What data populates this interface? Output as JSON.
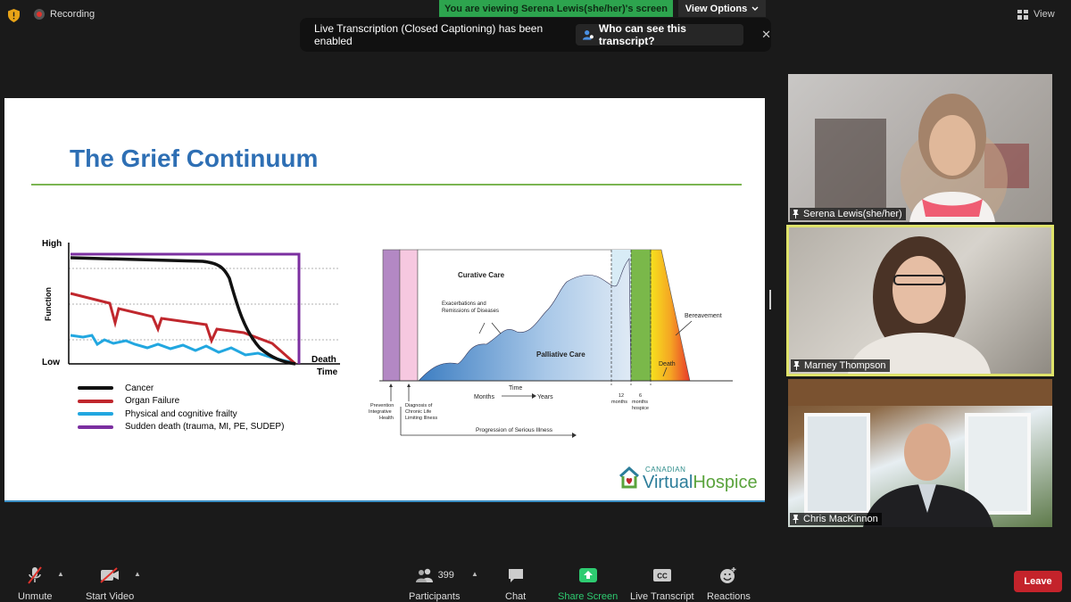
{
  "top_bar": {
    "recording_label": "Recording",
    "viewing_banner": "You are viewing Serena Lewis(she/her)'s screen",
    "view_options_label": "View Options",
    "view_label": "View"
  },
  "transcription_banner": {
    "message": "Live Transcription (Closed Captioning) has been enabled",
    "who_button": "Who can see this transcript?",
    "close_glyph": "✕"
  },
  "slide": {
    "title": "The Grief Continuum",
    "left_chart": {
      "y_high": "High",
      "y_low": "Low",
      "y_label": "Function",
      "x_death": "Death",
      "x_time": "Time",
      "legend": [
        {
          "name": "Cancer",
          "color": "#111111"
        },
        {
          "name": "Organ Failure",
          "color": "#c0272d"
        },
        {
          "name": "Physical and cognitive frailty",
          "color": "#22a7e0"
        },
        {
          "name": "Sudden death (trauma, MI, PE, SUDEP)",
          "color": "#7b2fa0"
        }
      ]
    },
    "right_diagram": {
      "curative": "Curative Care",
      "exacerbations_1": "Exacerbations and",
      "exacerbations_2": "Remissions of Diseases",
      "palliative": "Palliative Care",
      "bereavement": "Bereavement",
      "death": "Death",
      "time": "Time",
      "months": "Months",
      "years": "Years",
      "prevention_1": "Prevention",
      "prevention_2": "Integrative",
      "prevention_3": "Health",
      "diagnosis_1": "Diagnosis of",
      "diagnosis_2": "Chronic Life",
      "diagnosis_3": "Limiting Illness",
      "twelve_1": "12",
      "twelve_2": "months",
      "six_1": "6",
      "six_2": "months",
      "six_3": "hospice",
      "progression": "Progression of Serious Illness"
    },
    "logo_small": "CANADIAN",
    "logo_big_1": "Virtual",
    "logo_big_2": "Hospice"
  },
  "participants_video": [
    {
      "name": "Serena Lewis(she/her)"
    },
    {
      "name": "Marney Thompson"
    },
    {
      "name": "Chris MacKinnon"
    }
  ],
  "toolbar": {
    "unmute": "Unmute",
    "start_video": "Start Video",
    "participants": "Participants",
    "participant_count": "399",
    "chat": "Chat",
    "share_screen": "Share Screen",
    "live_transcript": "Live Transcript",
    "reactions": "Reactions",
    "leave": "Leave",
    "cc_glyph": "CC"
  },
  "colors": {
    "viewing_green": "#2da44e",
    "share_green": "#2ecc71",
    "leave_red": "#c4232b",
    "title_blue": "#2e6fb4",
    "active_speaker": "#dfe36a"
  }
}
